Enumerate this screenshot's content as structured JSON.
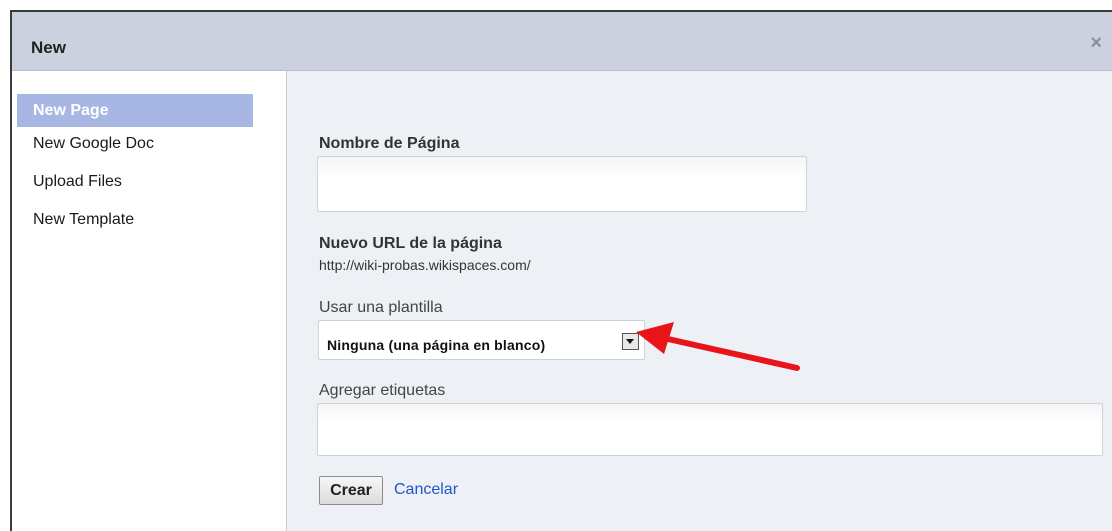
{
  "dialog": {
    "title": "New",
    "close_symbol": "×"
  },
  "sidebar": {
    "items": [
      {
        "label": "New Page",
        "active": true
      },
      {
        "label": "New Google Doc",
        "active": false
      },
      {
        "label": "Upload Files",
        "active": false
      },
      {
        "label": "New Template",
        "active": false
      }
    ]
  },
  "form": {
    "page_name_label": "Nombre de Página",
    "page_name_value": "",
    "url_label": "Nuevo URL de la página",
    "url_value": "http://wiki-probas.wikispaces.com/",
    "template_label": "Usar una plantilla",
    "template_selected": "Ninguna (una página en blanco)",
    "tags_label": "Agregar etiquetas",
    "tags_value": "",
    "create_button": "Crear",
    "cancel_link": "Cancelar"
  },
  "colors": {
    "titlebar": "#ccd1e0",
    "sidebar_active": "#a7b6e3",
    "content_bg": "#edf0f4",
    "link": "#1f56c9",
    "annotation_arrow": "#e8141a"
  },
  "icons": {
    "close": "close-icon",
    "dropdown": "chevron-down-icon",
    "annotation": "red-arrow"
  }
}
